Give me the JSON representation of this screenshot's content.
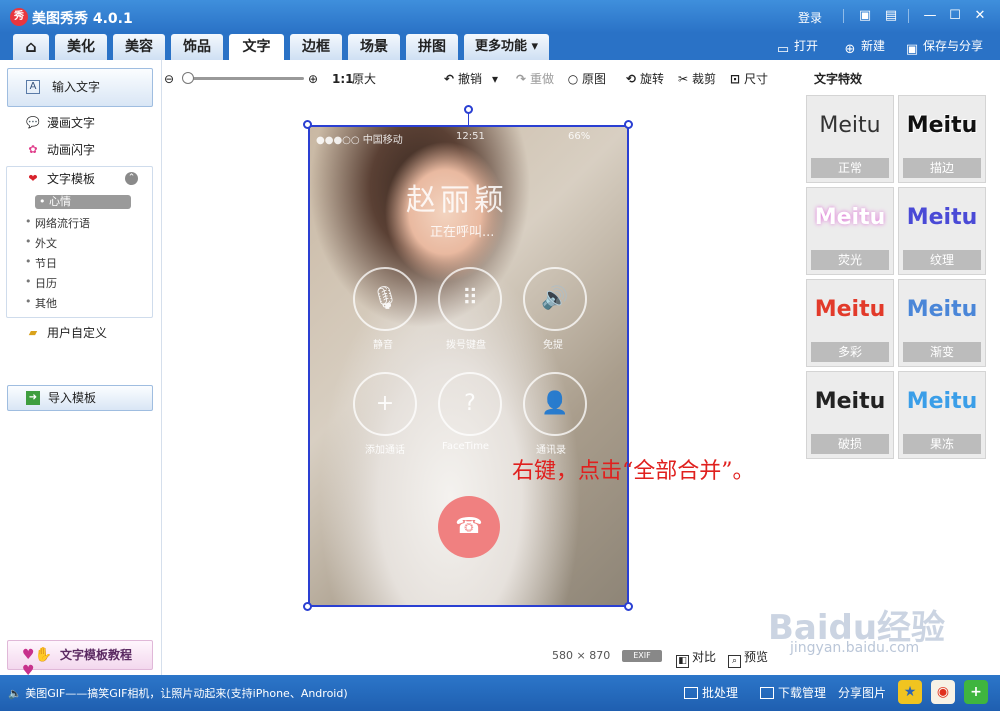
{
  "app": {
    "title": "美图秀秀 4.0.1",
    "logo_text": "秀",
    "login": "登录"
  },
  "window_controls": {
    "comment": "▣",
    "skin": "▤",
    "minimize": "—",
    "maximize": "☐",
    "close": "✕"
  },
  "nav": {
    "home_icon": "⌂",
    "tabs": [
      "美化",
      "美容",
      "饰品",
      "文字",
      "边框",
      "场景",
      "拼图",
      "更多功能"
    ],
    "more_arrow": "▾",
    "active_tab": "文字",
    "open": "打开",
    "new": "新建",
    "save_share": "保存与分享"
  },
  "left": {
    "input_text": "输入文字",
    "comic_text": "漫画文字",
    "anim_text": "动画闪字",
    "template": "文字模板",
    "template_subs": [
      "心情",
      "网络流行语",
      "外文",
      "节日",
      "日历",
      "其他"
    ],
    "template_selected": "心情",
    "custom": "用户自定义",
    "import": "导入模板",
    "tutorial": "文字模板教程"
  },
  "toolbar": {
    "zoom_ratio": "1:1",
    "original_size": "原大",
    "undo": "撤销",
    "redo": "重做",
    "original": "原图",
    "rotate": "旋转",
    "crop": "裁剪",
    "size": "尺寸"
  },
  "photo": {
    "carrier": "●●●○○ 中国移动",
    "time": "12:51",
    "battery": "66%",
    "caller": "赵丽颖",
    "calling": "正在呼叫...",
    "buttons": [
      {
        "label": "静音",
        "glyph": "🎙"
      },
      {
        "label": "拨号键盘",
        "glyph": "⠿"
      },
      {
        "label": "免提",
        "glyph": "🔊"
      },
      {
        "label": "添加通话",
        "glyph": "+"
      },
      {
        "label": "FaceTime",
        "glyph": "?"
      },
      {
        "label": "通讯录",
        "glyph": "👤"
      }
    ],
    "endcall_glyph": "☎"
  },
  "annotation": "右键，点击“全部合并”。",
  "canvas_footer": {
    "dimensions": "580 × 870",
    "exif": "EXIF",
    "compare": "对比",
    "preview": "预览"
  },
  "right": {
    "header": "文字特效",
    "effects": [
      {
        "preview": "Meitu",
        "name": "正常",
        "color": "#333333"
      },
      {
        "preview": "Meitu",
        "name": "描边",
        "color": "#111111"
      },
      {
        "preview": "Meitu",
        "name": "荧光",
        "color": "#f4a6e8"
      },
      {
        "preview": "Meitu",
        "name": "纹理",
        "color": "#4a4ad6"
      },
      {
        "preview": "Meitu",
        "name": "多彩",
        "color": "#e23a2a"
      },
      {
        "preview": "Meitu",
        "name": "渐变",
        "color": "#4a86d8"
      },
      {
        "preview": "Meitu",
        "name": "破损",
        "color": "#222222"
      },
      {
        "preview": "Meitu",
        "name": "果冻",
        "color": "#3a9ee8"
      }
    ]
  },
  "status": {
    "message": "美图GIF——搞笑GIF相机，让照片动起来(支持iPhone、Android)",
    "batch": "批处理",
    "download": "下载管理",
    "share": "分享图片"
  },
  "watermark": {
    "brand": "Baidu经验",
    "url": "jingyan.baidu.com"
  }
}
